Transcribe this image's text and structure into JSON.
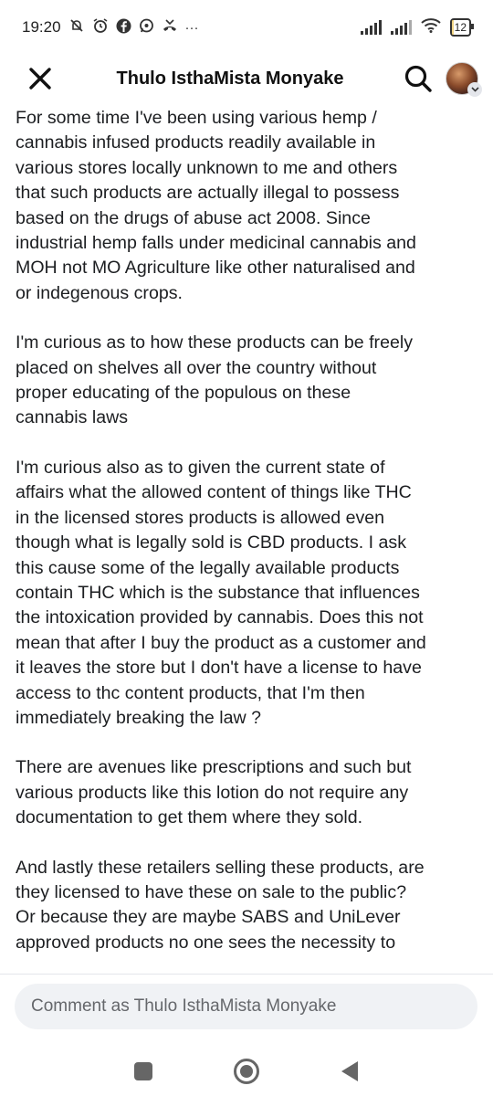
{
  "status_bar": {
    "time": "19:20",
    "battery_level": "12",
    "battery_fraction": 0.12,
    "icons": [
      "mute-icon",
      "alarm-icon",
      "facebook-icon",
      "whatsapp-icon",
      "missed-call-icon",
      "more-icon",
      "signal-icon",
      "signal-icon",
      "wifi-icon",
      "battery-icon"
    ],
    "more": "···"
  },
  "header": {
    "title": "Thulo IsthaMista Monyake"
  },
  "post": {
    "paragraphs": [
      "For some time I've been using various hemp /\ncannabis infused products readily available in\nvarious stores locally unknown to me and others\nthat such products are actually illegal to possess\nbased on the drugs of abuse act 2008. Since\nindustrial hemp falls under medicinal cannabis and\nMOH not MO Agriculture like other naturalised and\nor indegenous crops.",
      "I'm curious as to how these products can be freely\nplaced on shelves all over the country without\nproper educating of the populous on these\ncannabis laws",
      "I'm curious also as to given the current state of\naffairs what the allowed content of things like THC\nin the licensed stores products is allowed even\nthough what is legally sold is CBD products. I ask\nthis cause some of the legally available products\ncontain THC which is the substance that influences\nthe intoxication provided by cannabis. Does this not\nmean that after I buy the product as a customer and\nit leaves the store but I don't have a license to have\naccess to thc content products, that I'm then\nimmediately breaking the law ?",
      "There are avenues like prescriptions and such but\nvarious products like this lotion do not require any\ndocumentation to get them where they sold.",
      "And lastly these retailers selling these products, are\nthey licensed to have these on sale to the public?\nOr because they are maybe SABS and UniLever\napproved products no one sees the necessity to"
    ]
  },
  "comment": {
    "placeholder": "Comment as Thulo IsthaMista Monyake"
  },
  "nav": {
    "items": [
      "recents-icon",
      "home-icon",
      "back-icon"
    ]
  }
}
